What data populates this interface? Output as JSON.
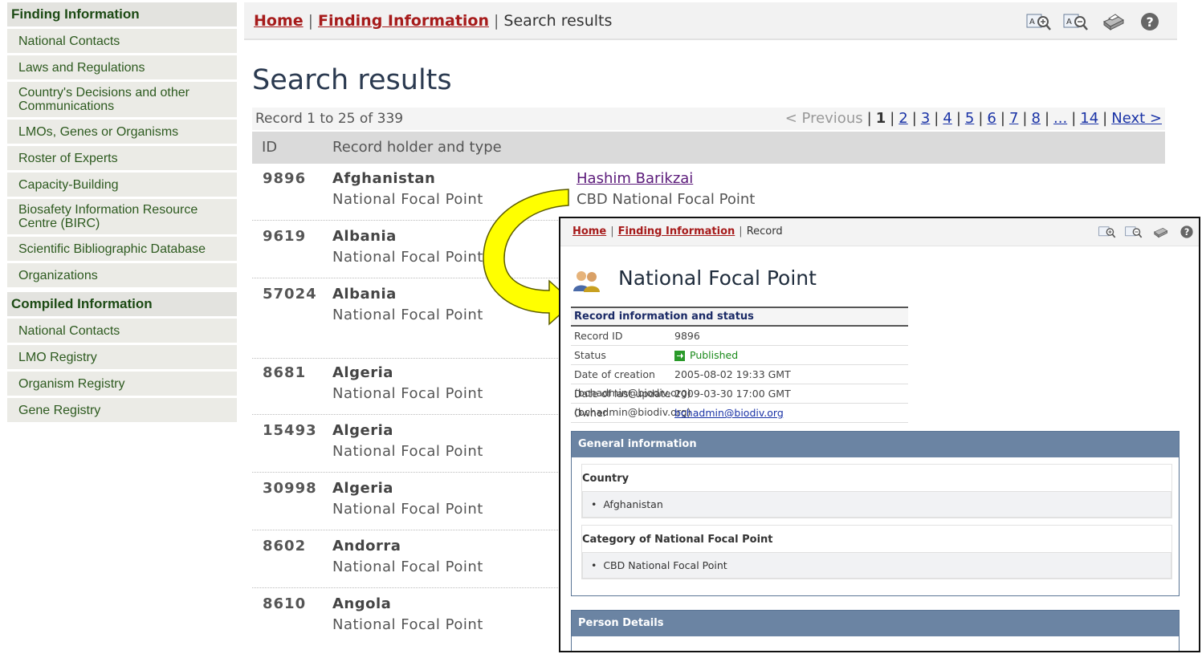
{
  "sidebar": {
    "sections": [
      {
        "title": "Finding Information",
        "items": [
          "National Contacts",
          "Laws and Regulations",
          "Country's Decisions and other Communications",
          "LMOs, Genes or Organisms",
          "Roster of Experts",
          "Capacity-Building",
          "Biosafety Information Resource Centre (BIRC)",
          "Scientific Bibliographic Database",
          "Organizations"
        ]
      },
      {
        "title": "Compiled Information",
        "items": [
          "National Contacts",
          "LMO Registry",
          "Organism Registry",
          "Gene Registry"
        ]
      }
    ]
  },
  "breadcrumb": {
    "home": "Home",
    "section": "Finding Information",
    "current": "Search results"
  },
  "toolbar_icons": [
    "zoom-in-icon",
    "zoom-out-icon",
    "print-icon",
    "help-icon"
  ],
  "page_title": "Search results",
  "results": {
    "count_text": "Record 1 to 25 of 339",
    "pager": {
      "previous": "< Previous",
      "current": "1",
      "pages": [
        "2",
        "3",
        "4",
        "5",
        "6",
        "7",
        "8",
        "...",
        "14"
      ],
      "next": "Next >"
    },
    "columns": [
      "ID",
      "Record holder and type"
    ],
    "rows": [
      {
        "id": "9896",
        "country": "Afghanistan",
        "type": "National Focal Point",
        "person": "Hashim Barikzai",
        "person_type": "CBD National Focal Point"
      },
      {
        "id": "9619",
        "country": "Albania",
        "type": "National Focal Point"
      },
      {
        "id": "57024",
        "country": "Albania",
        "type": "National Focal Point"
      },
      {
        "id": "8681",
        "country": "Algeria",
        "type": "National Focal Point"
      },
      {
        "id": "15493",
        "country": "Algeria",
        "type": "National Focal Point"
      },
      {
        "id": "30998",
        "country": "Algeria",
        "type": "National Focal Point"
      },
      {
        "id": "8602",
        "country": "Andorra",
        "type": "National Focal Point"
      },
      {
        "id": "8610",
        "country": "Angola",
        "type": "National Focal Point"
      }
    ]
  },
  "detail": {
    "breadcrumb": {
      "home": "Home",
      "section": "Finding Information",
      "current": "Record"
    },
    "title": "National Focal Point",
    "record_info": {
      "header": "Record information and status",
      "record_id_label": "Record ID",
      "record_id": "9896",
      "status_label": "Status",
      "status": "Published",
      "created_label": "Date of creation",
      "created": "2005-08-02 19:33 GMT (bchadmin@biodiv.org)",
      "updated_label": "Date of last update",
      "updated": "2009-03-30 17:00 GMT (bchadmin@biodiv.org)",
      "owner_label": "Owner",
      "owner": "bchadmin@biodiv.org"
    },
    "general": {
      "header": "General information",
      "country_label": "Country",
      "country": "Afghanistan",
      "category_label": "Category of National Focal Point",
      "category": "CBD National Focal Point"
    },
    "person": {
      "header": "Person Details"
    }
  },
  "colors": {
    "sidebar_heading": "#1c4a14",
    "breadcrumb_link": "#a61b1b",
    "link": "#1a33a6",
    "section_header": "#6b84a3",
    "arrow_fill": "#ffff00",
    "arrow_stroke": "#6b6b00"
  }
}
